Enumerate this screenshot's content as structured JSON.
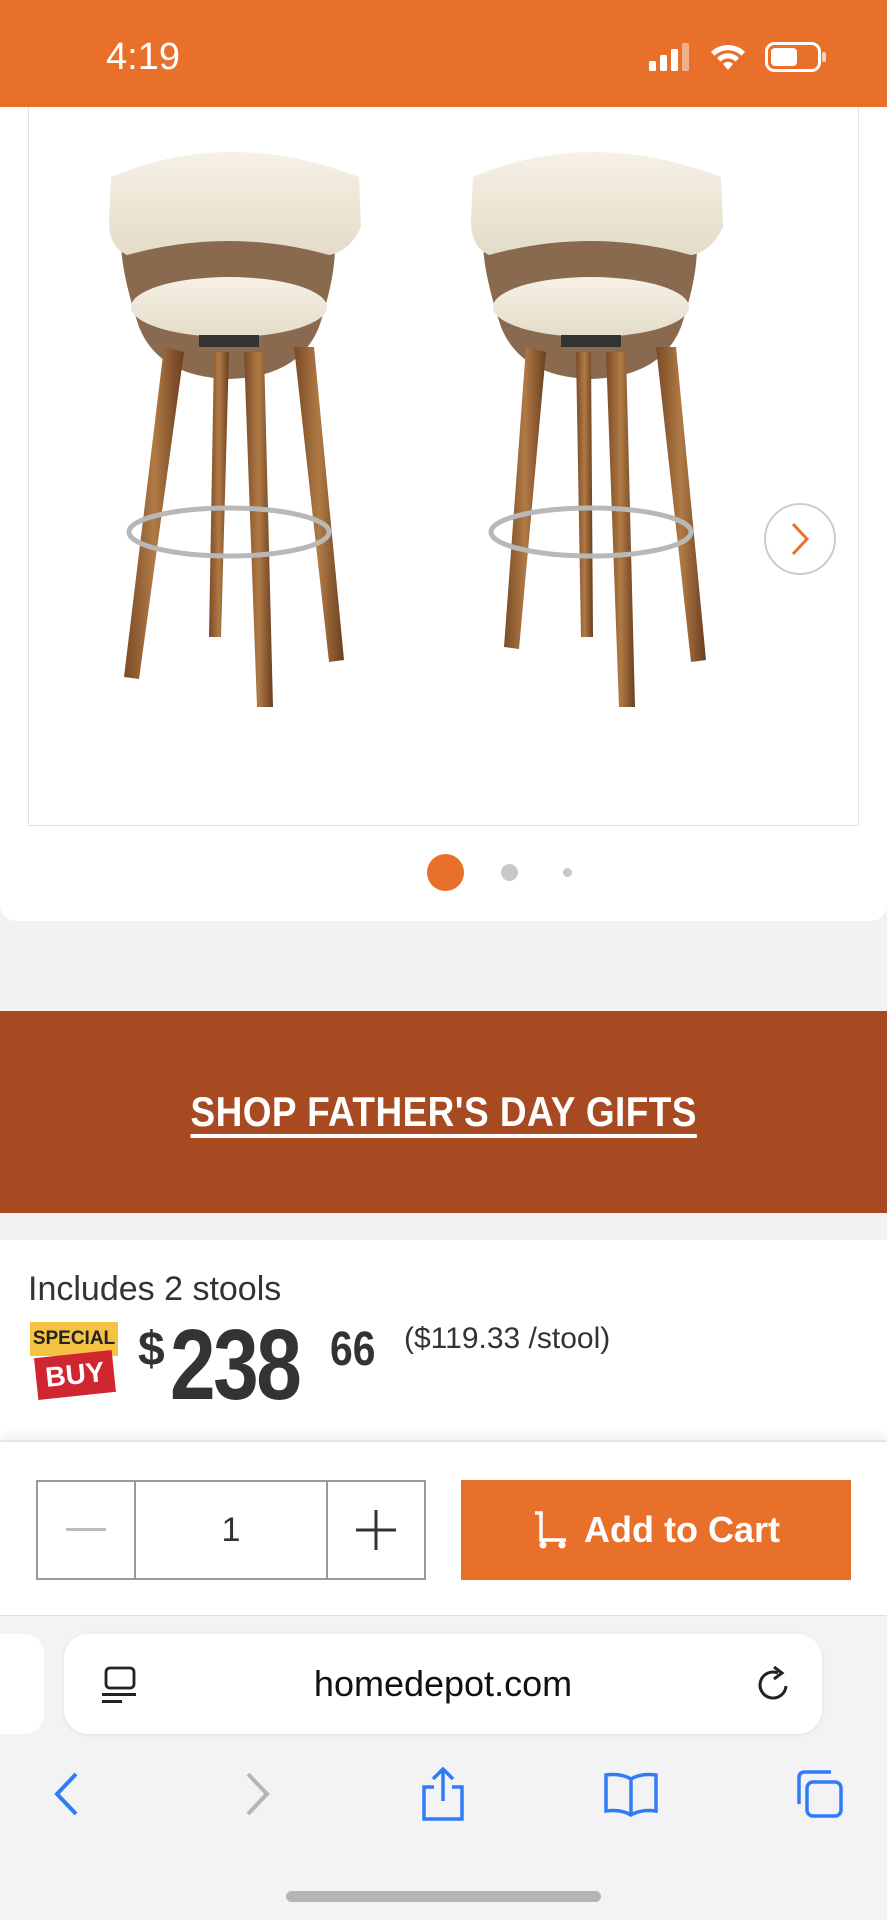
{
  "status_bar": {
    "time": "4:19",
    "icons": [
      "cellular-signal-icon",
      "wifi-icon",
      "battery-icon"
    ]
  },
  "product_images": {
    "image_alt": "Two cream upholstered swivel bar stools with walnut bentwood legs and chrome footrest",
    "carousel_dots": 3,
    "active_dot": 0,
    "next_arrow_icon": "chevron-right-icon"
  },
  "promo_banner": {
    "label": "SHOP FATHER'S DAY GIFTS"
  },
  "pricing": {
    "includes": "Includes 2 stools",
    "badge_top": "SPECIAL",
    "badge_bottom": "BUY",
    "currency_symbol": "$",
    "price_whole": "238",
    "price_cents": "66",
    "unit_price": "($119.33 /stool)"
  },
  "cart": {
    "quantity": "1",
    "decrement_icon": "minus-icon",
    "increment_icon": "plus-icon",
    "add_label": "Add to Cart",
    "cart_icon": "dolly-cart-icon"
  },
  "browser": {
    "url": "homedepot.com",
    "toolbar_icons": [
      "back-icon",
      "forward-icon",
      "share-icon",
      "bookmarks-icon",
      "tabs-icon"
    ]
  },
  "colors": {
    "brand_orange": "#e8702a",
    "banner_brown": "#a84a21",
    "ios_blue": "#2f7cf6",
    "special_yellow": "#f6c244",
    "special_red": "#d0262f"
  }
}
